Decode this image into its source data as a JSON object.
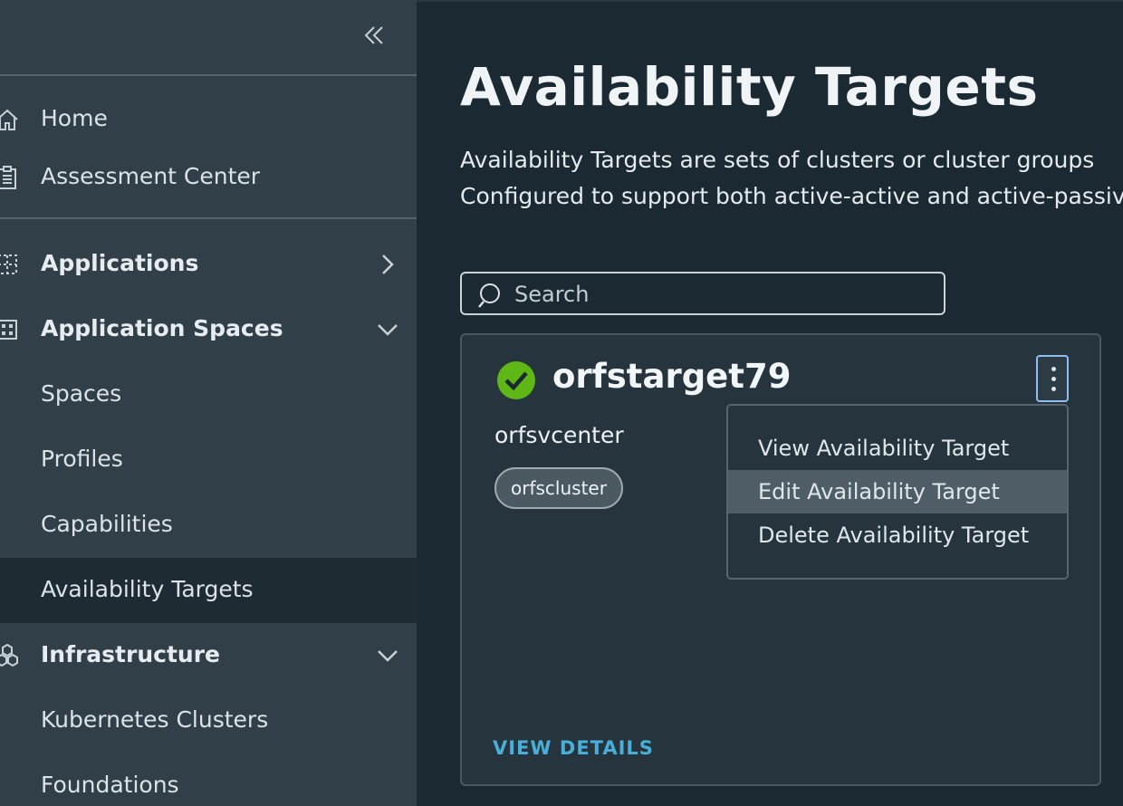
{
  "sidebar": {
    "collapse_icon": "double-chevron-left-icon",
    "items": [
      {
        "label": "Home",
        "icon": "home-icon"
      },
      {
        "label": "Assessment Center",
        "icon": "clipboard-icon"
      },
      {
        "label": "Applications",
        "icon": "grid-icon",
        "chevron": "right"
      },
      {
        "label": "Application Spaces",
        "icon": "building-grid-icon",
        "chevron": "down"
      },
      {
        "label": "Spaces"
      },
      {
        "label": "Profiles"
      },
      {
        "label": "Capabilities"
      },
      {
        "label": "Availability Targets",
        "active": true
      },
      {
        "label": "Infrastructure",
        "icon": "hexagons-icon",
        "chevron": "down"
      },
      {
        "label": "Kubernetes Clusters"
      },
      {
        "label": "Foundations"
      }
    ]
  },
  "main": {
    "title": "Availability Targets",
    "description_line1": "Availability Targets are sets of clusters or cluster groups",
    "description_line2": "Configured to support both active-active and active-passive",
    "search": {
      "placeholder": "Search",
      "value": ""
    },
    "card": {
      "status": "success",
      "name": "orfstarget79",
      "vcenter": "orfsvcenter",
      "cluster_chip": "orfscluster",
      "view_details": "VIEW DETAILS"
    },
    "context_menu": {
      "items": [
        {
          "label": "View Availability Target"
        },
        {
          "label": "Edit Availability Target",
          "hovered": true
        },
        {
          "label": "Delete Availability Target"
        }
      ]
    }
  },
  "colors": {
    "sidebar_bg": "#313f48",
    "sidebar_active_bg": "#1e2b33",
    "main_bg": "#1b2a32",
    "card_bg": "#25343d",
    "link_blue": "#49afd9",
    "success_green": "#5eb715",
    "focus_blue": "#8fbff0"
  }
}
